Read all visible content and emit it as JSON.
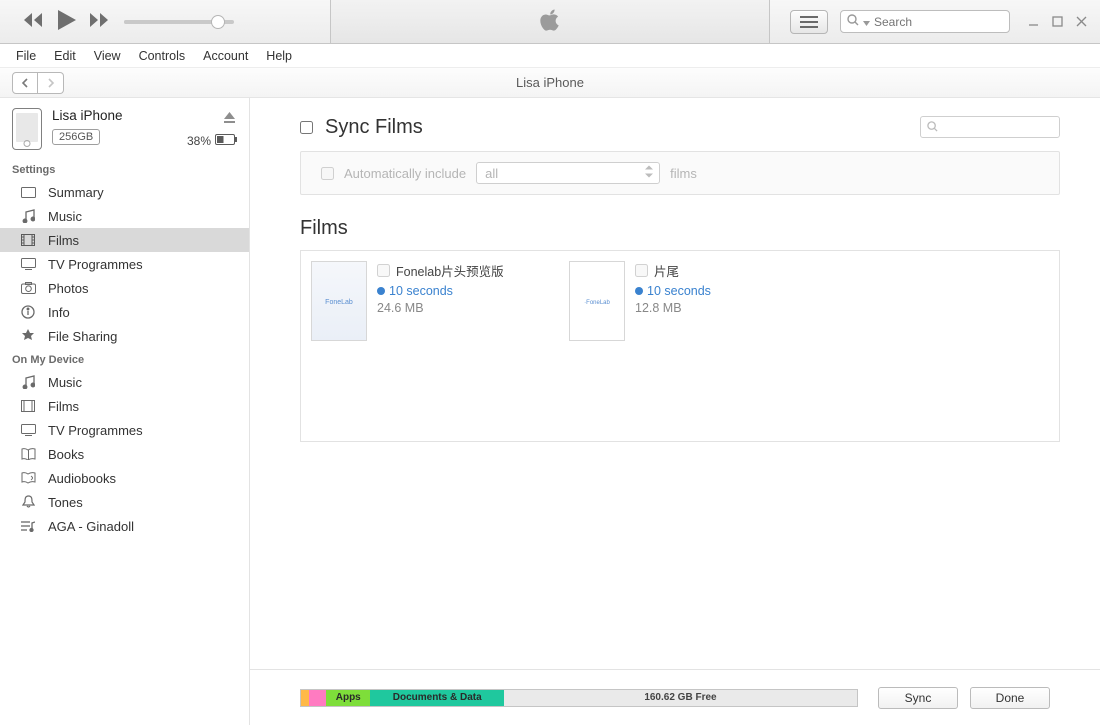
{
  "window": {
    "title": "Lisa iPhone"
  },
  "menus": [
    "File",
    "Edit",
    "View",
    "Controls",
    "Account",
    "Help"
  ],
  "search": {
    "placeholder": "Search"
  },
  "device": {
    "name": "Lisa iPhone",
    "capacity": "256GB",
    "battery": "38%"
  },
  "sections": {
    "settings_label": "Settings",
    "settings": [
      "Summary",
      "Music",
      "Films",
      "TV Programmes",
      "Photos",
      "Info",
      "File Sharing"
    ],
    "on_device_label": "On My Device",
    "on_device": [
      "Music",
      "Films",
      "TV Programmes",
      "Books",
      "Audiobooks",
      "Tones",
      "AGA - Ginadoll"
    ]
  },
  "sync": {
    "heading": "Sync Films",
    "auto_label_pre": "Automatically include",
    "auto_select": "all",
    "auto_label_post": "films"
  },
  "films_heading": "Films",
  "films": [
    {
      "title": "Fonelab片头预览版",
      "duration": "10 seconds",
      "size": "24.6 MB"
    },
    {
      "title": "片尾",
      "duration": "10 seconds",
      "size": "12.8 MB"
    }
  ],
  "storage": {
    "segments": [
      {
        "label": "",
        "color": "orange",
        "width": "1.5%"
      },
      {
        "label": "",
        "color": "pink",
        "width": "3%"
      },
      {
        "label": "Apps",
        "color": "green",
        "width": "8%"
      },
      {
        "label": "Documents & Data",
        "color": "teal",
        "width": "24%"
      }
    ],
    "free": "160.62 GB Free"
  },
  "buttons": {
    "sync": "Sync",
    "done": "Done"
  }
}
